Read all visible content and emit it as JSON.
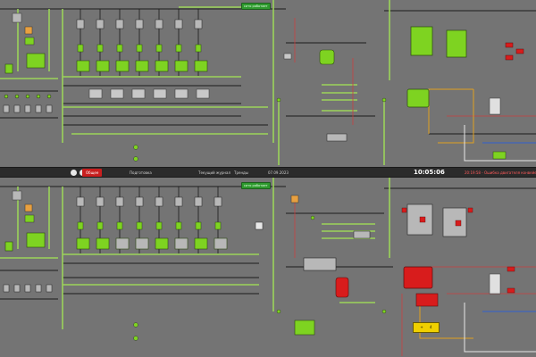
{
  "status_bar": {
    "active_tab": "Общее",
    "tab2": "Подготовка",
    "tab3": "Текущий журнал",
    "tab4": "Тренды",
    "date": "07.09.2023",
    "time": "10:05:06",
    "alarm_text": "20:19:58 - Ошибка двигателя конвейера"
  },
  "badges": {
    "top_status": "сито работает",
    "bottom_status": "сито работает"
  },
  "indicator": {
    "plus_sign": "+",
    "level": "4"
  },
  "colors": {
    "background": "#747474",
    "pipe": "#1b1b1b",
    "active_green": "#7ed321",
    "line_green": "#9bd35a",
    "alarm_red": "#d81c1c",
    "yellow": "#f0d000",
    "inactive_gray": "#b8b8b8",
    "status_bar": "#2b2b2b"
  }
}
